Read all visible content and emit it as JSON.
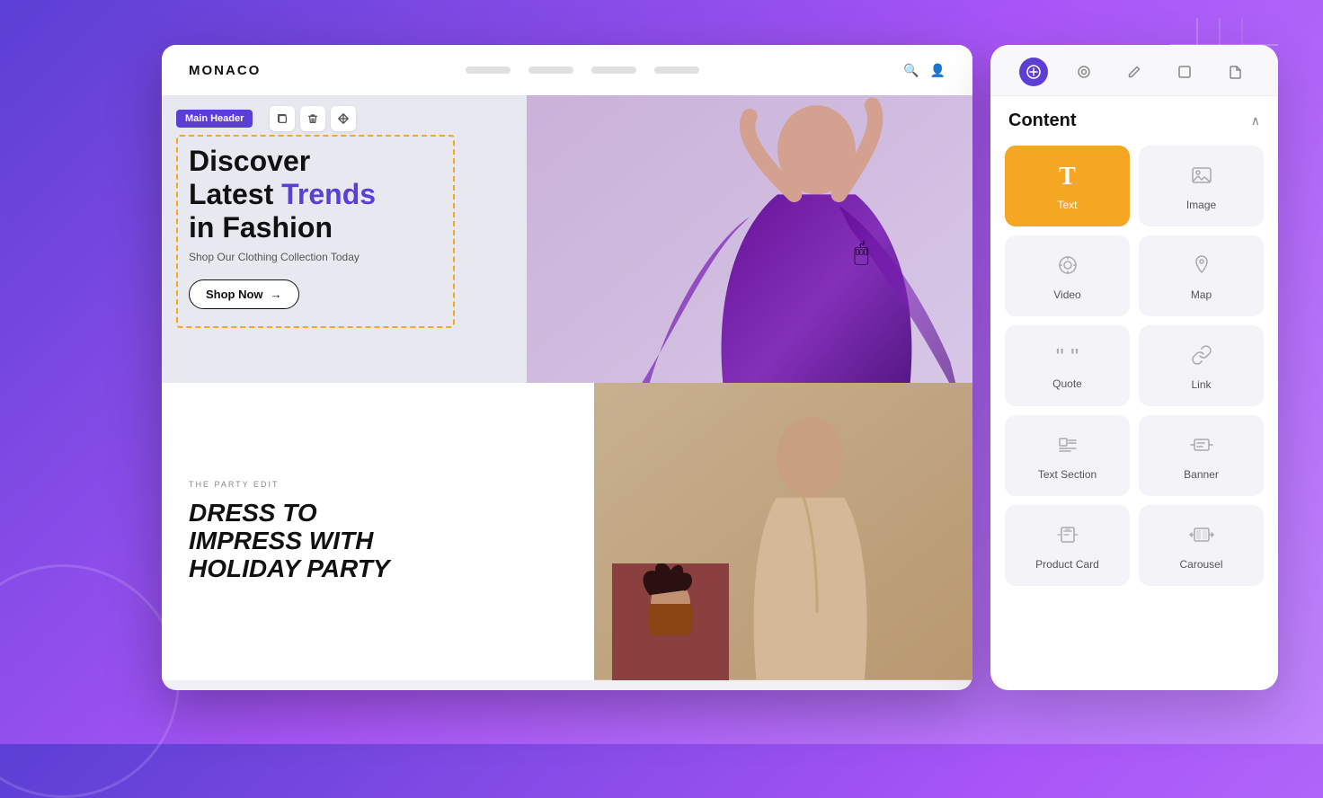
{
  "background": {
    "gradient_start": "#5b3fd4",
    "gradient_end": "#c084fc"
  },
  "website_card": {
    "nav": {
      "logo": "MONACO",
      "links": [
        "",
        "",
        "",
        ""
      ],
      "icon_search": "🔍",
      "icon_user": "👤"
    },
    "hero": {
      "badge_label": "Main Header",
      "toolbar_buttons": [
        "copy-icon",
        "trash-icon",
        "move-icon"
      ],
      "title_line1": "Discover",
      "title_line2": "Latest ",
      "title_accent": "Trends",
      "title_line3": "in Fashion",
      "subtitle": "Shop Our Clothing Collection Today",
      "cta_label": "Shop Now",
      "cta_arrow": "→"
    },
    "second": {
      "category": "THE PARTY EDIT",
      "title_line1": "DRESS TO",
      "title_line2": "IMPRESS WITH",
      "title_line3": "HOLIDAY PARTY"
    }
  },
  "panel": {
    "tabs": [
      {
        "icon": "⊕",
        "label": "add",
        "active": true
      },
      {
        "icon": "◎",
        "label": "layers",
        "active": false
      },
      {
        "icon": "✏",
        "label": "edit",
        "active": false
      },
      {
        "icon": "▭",
        "label": "layout",
        "active": false
      },
      {
        "icon": "☐",
        "label": "page",
        "active": false
      }
    ],
    "content_section": {
      "title": "Content",
      "collapse_icon": "∧"
    },
    "items": [
      {
        "id": "text",
        "label": "Text",
        "icon": "T",
        "highlighted": true
      },
      {
        "id": "image",
        "label": "Image",
        "icon": "🖼",
        "highlighted": false
      },
      {
        "id": "video",
        "label": "Video",
        "icon": "▶",
        "highlighted": false
      },
      {
        "id": "map",
        "label": "Map",
        "icon": "📍",
        "highlighted": false
      },
      {
        "id": "quote",
        "label": "Quote",
        "icon": "❝❞",
        "highlighted": false
      },
      {
        "id": "link",
        "label": "Link",
        "icon": "🔗",
        "highlighted": false
      },
      {
        "id": "text-section",
        "label": "Text Section",
        "icon": "≡",
        "highlighted": false
      },
      {
        "id": "banner",
        "label": "Banner",
        "icon": "⊡≡",
        "highlighted": false
      },
      {
        "id": "product-card",
        "label": "Product Card",
        "icon": "🛍",
        "highlighted": false
      },
      {
        "id": "carousel",
        "label": "Carousel",
        "icon": "◁▷",
        "highlighted": false
      }
    ]
  }
}
